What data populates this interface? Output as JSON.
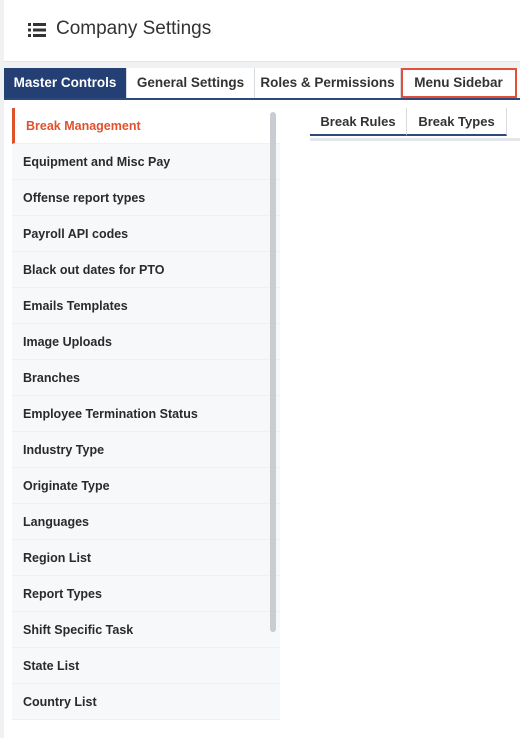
{
  "header": {
    "title": "Company Settings",
    "icon": "list-icon"
  },
  "tabs": [
    {
      "label": "Master Controls",
      "active": true
    },
    {
      "label": "General Settings",
      "active": false
    },
    {
      "label": "Roles & Permissions",
      "active": false
    },
    {
      "label": "Menu Sidebar",
      "active": false,
      "highlighted": true
    }
  ],
  "sidebar": {
    "items": [
      {
        "label": "Break Management",
        "active": true
      },
      {
        "label": "Equipment and Misc Pay"
      },
      {
        "label": "Offense report types"
      },
      {
        "label": "Payroll API codes"
      },
      {
        "label": "Black out dates for PTO"
      },
      {
        "label": "Emails Templates"
      },
      {
        "label": "Image Uploads"
      },
      {
        "label": "Branches"
      },
      {
        "label": "Employee Termination Status"
      },
      {
        "label": "Industry Type"
      },
      {
        "label": "Originate Type"
      },
      {
        "label": "Languages"
      },
      {
        "label": "Region List"
      },
      {
        "label": "Report Types"
      },
      {
        "label": "Shift Specific Task"
      },
      {
        "label": "State List"
      },
      {
        "label": "Country List"
      }
    ]
  },
  "subtabs": [
    {
      "label": "Break Rules"
    },
    {
      "label": "Break Types"
    }
  ],
  "colors": {
    "primary": "#233f73",
    "accent": "#e0522e",
    "highlight": "#e2503a"
  }
}
